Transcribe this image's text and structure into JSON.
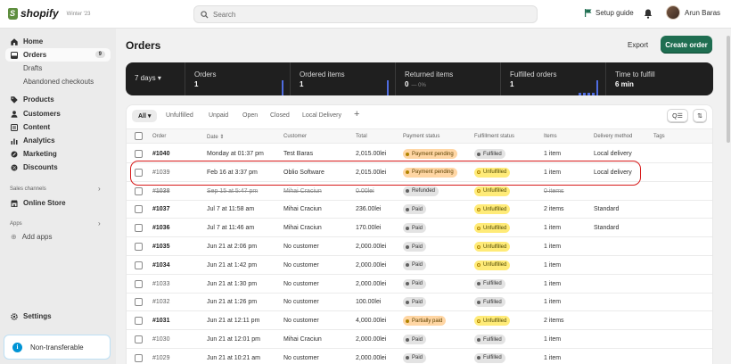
{
  "app": {
    "name": "shopify",
    "version": "Winter '23"
  },
  "search": {
    "placeholder": "Search"
  },
  "header": {
    "setup_guide": "Setup guide",
    "user_name": "Arun Baras"
  },
  "sidebar": {
    "items": [
      {
        "label": "Home",
        "icon": "home-icon"
      },
      {
        "label": "Orders",
        "icon": "orders-icon",
        "badge": "9",
        "active": true
      },
      {
        "label": "Drafts",
        "sub": true
      },
      {
        "label": "Abandoned checkouts",
        "sub": true
      },
      {
        "label": "Products",
        "icon": "tag-icon"
      },
      {
        "label": "Customers",
        "icon": "person-icon"
      },
      {
        "label": "Content",
        "icon": "content-icon"
      },
      {
        "label": "Analytics",
        "icon": "analytics-icon"
      },
      {
        "label": "Marketing",
        "icon": "marketing-icon"
      },
      {
        "label": "Discounts",
        "icon": "discount-icon"
      }
    ],
    "sales_channels_label": "Sales channels",
    "online_store": "Online Store",
    "apps_label": "Apps",
    "add_apps": "Add apps",
    "settings": "Settings",
    "non_transferable": "Non-transferable"
  },
  "page": {
    "title": "Orders",
    "export": "Export",
    "create_order": "Create order"
  },
  "stats": {
    "range": "7 days",
    "items": [
      {
        "label": "Orders",
        "value": "1"
      },
      {
        "label": "Ordered items",
        "value": "1"
      },
      {
        "label": "Returned items",
        "value": "0",
        "sub": "— 0%"
      },
      {
        "label": "Fulfilled orders",
        "value": "1"
      },
      {
        "label": "Time to fulfill",
        "value": "6 min"
      }
    ]
  },
  "tabs": [
    "All",
    "Unfulfilled",
    "Unpaid",
    "Open",
    "Closed",
    "Local Delivery"
  ],
  "columns": [
    "Order",
    "Date",
    "Customer",
    "Total",
    "Payment status",
    "Fulfillment status",
    "Items",
    "Delivery method",
    "Tags"
  ],
  "rows": [
    {
      "order": "#1040",
      "date": "Monday at 01:37 pm",
      "customer": "Test Baras",
      "total": "2,015.00lei",
      "payment": "Payment pending",
      "payment_style": "orange",
      "fulfillment": "Fulfilled",
      "fulfillment_style": "grey",
      "items": "1 item",
      "delivery": "Local delivery",
      "weight": "bold"
    },
    {
      "order": "#1039",
      "date": "Feb 16 at 3:37 pm",
      "customer": "Oblio Software",
      "total": "2,015.00lei",
      "payment": "Payment pending",
      "payment_style": "orange",
      "fulfillment": "Unfulfilled",
      "fulfillment_style": "yellow",
      "items": "1 item",
      "delivery": "Local delivery",
      "weight": "normal"
    },
    {
      "order": "#1038",
      "date": "Sep 15 at 5:47 pm",
      "customer": "Mihai Craciun",
      "total": "0.00lei",
      "payment": "Refunded",
      "payment_style": "grey",
      "fulfillment": "Unfulfilled",
      "fulfillment_style": "yellow",
      "items": "0 items",
      "delivery": "",
      "weight": "strike"
    },
    {
      "order": "#1037",
      "date": "Jul 7 at 11:58 am",
      "customer": "Mihai Craciun",
      "total": "236.00lei",
      "payment": "Paid",
      "payment_style": "grey",
      "fulfillment": "Unfulfilled",
      "fulfillment_style": "yellow",
      "items": "2 items",
      "delivery": "Standard",
      "weight": "bold"
    },
    {
      "order": "#1036",
      "date": "Jul 7 at 11:46 am",
      "customer": "Mihai Craciun",
      "total": "170.00lei",
      "payment": "Paid",
      "payment_style": "grey",
      "fulfillment": "Unfulfilled",
      "fulfillment_style": "yellow",
      "items": "1 item",
      "delivery": "Standard",
      "weight": "bold"
    },
    {
      "order": "#1035",
      "date": "Jun 21 at 2:06 pm",
      "customer": "No customer",
      "total": "2,000.00lei",
      "payment": "Paid",
      "payment_style": "grey",
      "fulfillment": "Unfulfilled",
      "fulfillment_style": "yellow",
      "items": "1 item",
      "delivery": "",
      "weight": "bold"
    },
    {
      "order": "#1034",
      "date": "Jun 21 at 1:42 pm",
      "customer": "No customer",
      "total": "2,000.00lei",
      "payment": "Paid",
      "payment_style": "grey",
      "fulfillment": "Unfulfilled",
      "fulfillment_style": "yellow",
      "items": "1 item",
      "delivery": "",
      "weight": "bold"
    },
    {
      "order": "#1033",
      "date": "Jun 21 at 1:30 pm",
      "customer": "No customer",
      "total": "2,000.00lei",
      "payment": "Paid",
      "payment_style": "grey",
      "fulfillment": "Fulfilled",
      "fulfillment_style": "grey",
      "items": "1 item",
      "delivery": "",
      "weight": "normal"
    },
    {
      "order": "#1032",
      "date": "Jun 21 at 1:26 pm",
      "customer": "No customer",
      "total": "100.00lei",
      "payment": "Paid",
      "payment_style": "grey",
      "fulfillment": "Fulfilled",
      "fulfillment_style": "grey",
      "items": "1 item",
      "delivery": "",
      "weight": "normal"
    },
    {
      "order": "#1031",
      "date": "Jun 21 at 12:11 pm",
      "customer": "No customer",
      "total": "4,000.00lei",
      "payment": "Partially paid",
      "payment_style": "orange",
      "fulfillment": "Unfulfilled",
      "fulfillment_style": "yellow",
      "items": "2 items",
      "delivery": "",
      "weight": "bold"
    },
    {
      "order": "#1030",
      "date": "Jun 21 at 12:01 pm",
      "customer": "Mihai Craciun",
      "total": "2,000.00lei",
      "payment": "Paid",
      "payment_style": "grey",
      "fulfillment": "Fulfilled",
      "fulfillment_style": "grey",
      "items": "1 item",
      "delivery": "",
      "weight": "normal"
    },
    {
      "order": "#1029",
      "date": "Jun 21 at 10:21 am",
      "customer": "No customer",
      "total": "2,000.00lei",
      "payment": "Paid",
      "payment_style": "grey",
      "fulfillment": "Fulfilled",
      "fulfillment_style": "grey",
      "items": "1 item",
      "delivery": "",
      "weight": "normal"
    }
  ],
  "colors": {
    "brand_green": "#1f6e51",
    "highlight_red": "#d71a1a",
    "stats_bg": "#1f1f1f"
  }
}
